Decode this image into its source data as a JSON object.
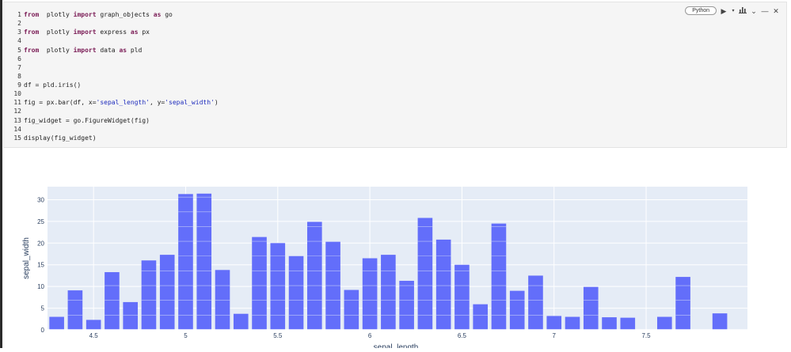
{
  "cell": {
    "language_label": "Python",
    "lines": [
      {
        "n": "1",
        "parts": [
          [
            "kw",
            "from"
          ],
          [
            "",
            "  plotly "
          ],
          [
            "kw",
            "import"
          ],
          [
            "",
            " graph_objects "
          ],
          [
            "kw",
            "as"
          ],
          [
            "",
            " go"
          ]
        ]
      },
      {
        "n": "2",
        "parts": []
      },
      {
        "n": "3",
        "parts": [
          [
            "kw",
            "from"
          ],
          [
            "",
            "  plotly "
          ],
          [
            "kw",
            "import"
          ],
          [
            "",
            " express "
          ],
          [
            "kw",
            "as"
          ],
          [
            "",
            " px"
          ]
        ]
      },
      {
        "n": "4",
        "parts": []
      },
      {
        "n": "5",
        "parts": [
          [
            "kw",
            "from"
          ],
          [
            "",
            "  plotly "
          ],
          [
            "kw",
            "import"
          ],
          [
            "",
            " data "
          ],
          [
            "kw",
            "as"
          ],
          [
            "",
            " pld"
          ]
        ]
      },
      {
        "n": "6",
        "parts": []
      },
      {
        "n": "7",
        "parts": []
      },
      {
        "n": "8",
        "parts": []
      },
      {
        "n": "9",
        "parts": [
          [
            "",
            "df = pld.iris()"
          ]
        ]
      },
      {
        "n": "10",
        "parts": []
      },
      {
        "n": "11",
        "parts": [
          [
            "",
            "fig = px.bar(df, x="
          ],
          [
            "str",
            "'sepal_length'"
          ],
          [
            "",
            ", y="
          ],
          [
            "str",
            "'sepal_width'"
          ],
          [
            "",
            ")"
          ]
        ]
      },
      {
        "n": "12",
        "parts": []
      },
      {
        "n": "13",
        "parts": [
          [
            "",
            "fig_widget = go.FigureWidget(fig)"
          ]
        ]
      },
      {
        "n": "14",
        "parts": []
      },
      {
        "n": "15",
        "parts": [
          [
            "",
            "display(fig_widget)"
          ]
        ]
      }
    ]
  },
  "toolbar": {
    "icons": [
      "run-icon",
      "run-dropdown-icon",
      "chart-icon",
      "collapse-icon",
      "minimize-icon",
      "close-icon"
    ]
  },
  "chart_data": {
    "type": "bar",
    "xlabel": "sepal_length",
    "ylabel": "sepal_width",
    "ylim": [
      0,
      33
    ],
    "xlim": [
      4.25,
      8.05
    ],
    "xticks": [
      4.5,
      5,
      5.5,
      6,
      6.5,
      7,
      7.5
    ],
    "xtick_labels": [
      "4.5",
      "5",
      "5.5",
      "6",
      "6.5",
      "7",
      "7.5"
    ],
    "yticks": [
      0,
      5,
      10,
      15,
      20,
      25,
      30
    ],
    "ytick_labels": [
      "0",
      "5",
      "10",
      "15",
      "20",
      "25",
      "30"
    ],
    "x": [
      4.3,
      4.4,
      4.5,
      4.6,
      4.7,
      4.8,
      4.9,
      5.0,
      5.1,
      5.2,
      5.3,
      5.4,
      5.5,
      5.6,
      5.7,
      5.8,
      5.9,
      6.0,
      6.1,
      6.2,
      6.3,
      6.4,
      6.5,
      6.6,
      6.7,
      6.8,
      6.9,
      7.0,
      7.1,
      7.2,
      7.3,
      7.4,
      7.6,
      7.7,
      7.9
    ],
    "values": [
      3.0,
      9.1,
      2.3,
      13.3,
      6.4,
      16.0,
      17.3,
      31.3,
      31.4,
      13.8,
      3.7,
      21.4,
      20.0,
      17.0,
      24.9,
      20.3,
      9.2,
      16.5,
      17.3,
      11.3,
      25.8,
      20.8,
      15.0,
      5.9,
      24.5,
      9.0,
      12.5,
      3.2,
      3.0,
      9.9,
      2.9,
      2.8,
      3.0,
      12.2,
      3.8
    ],
    "bar_color": "#636efa",
    "plot_bg": "#e5ecf6",
    "grid": true
  }
}
